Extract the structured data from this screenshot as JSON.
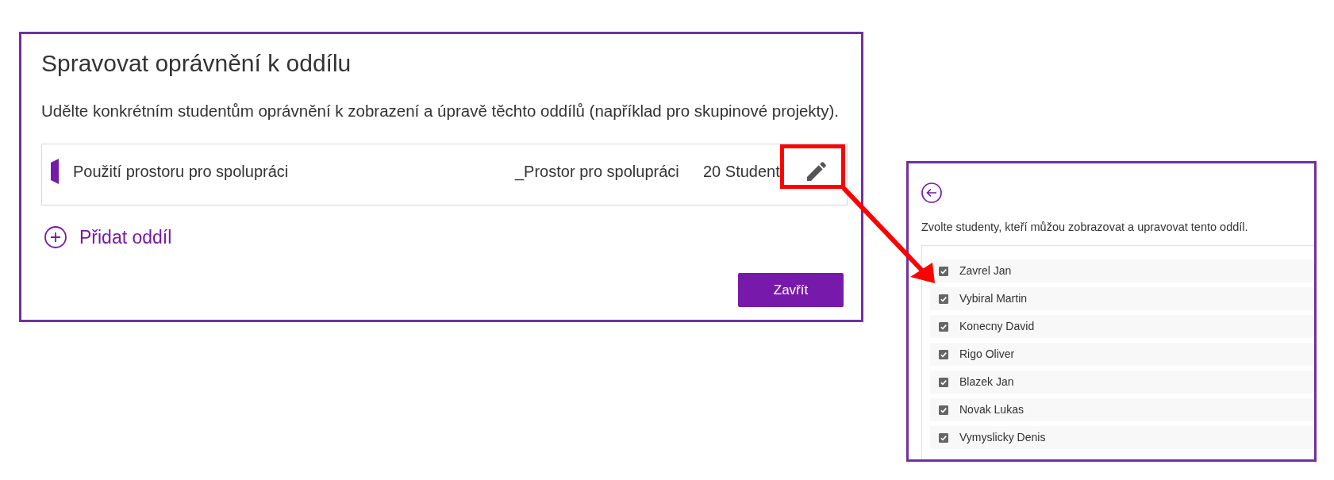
{
  "dialog": {
    "title": "Spravovat oprávnění k oddílu",
    "description": "Udělte konkrétním studentům oprávnění k zobrazení a úpravě těchto oddílů (například pro skupinové projekty).",
    "sections": [
      {
        "name": "Použití prostoru pro spolupráci",
        "location": "_Prostor pro spolupráci",
        "count": "20 Student",
        "highlighted": true
      }
    ],
    "add_section": "Přidat oddíl",
    "close_button": "Zavřít"
  },
  "student_panel": {
    "instruction": "Zvolte studenty, kteří můžou zobrazovat a upravovat tento oddíl.",
    "students": [
      {
        "name": "Zavrel Jan",
        "checked": true
      },
      {
        "name": "Vybiral Martin",
        "checked": true
      },
      {
        "name": "Konecny David",
        "checked": true
      },
      {
        "name": "Rigo Oliver",
        "checked": true
      },
      {
        "name": "Blazek Jan",
        "checked": true
      },
      {
        "name": "Novak Lukas",
        "checked": true
      },
      {
        "name": "Vymyslicky Denis",
        "checked": true
      }
    ]
  }
}
